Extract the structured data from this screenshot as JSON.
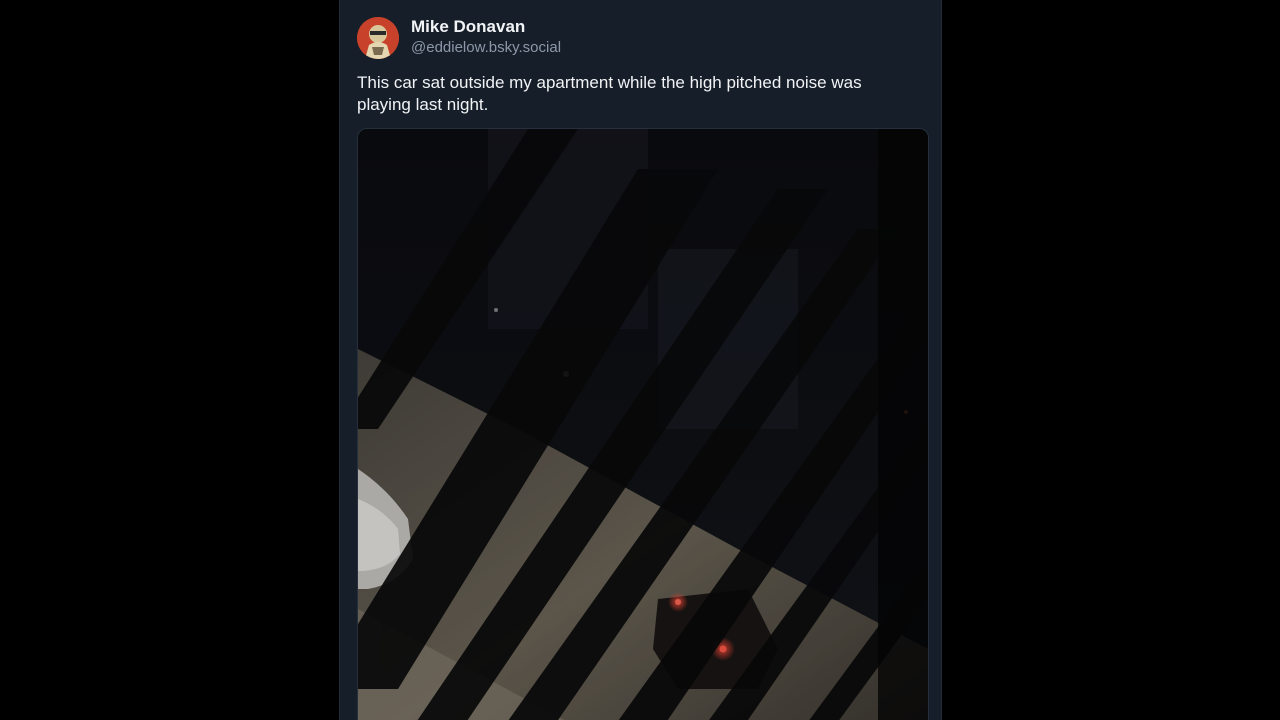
{
  "post": {
    "author_name": "Mike Donavan",
    "author_handle": "@eddielow.bsky.social",
    "text": "This car sat outside my apartment while the high pitched noise was playing last night.",
    "avatar_icon": "avatar-image",
    "media_icon": "night-photo-image"
  },
  "colors": {
    "background": "#000000",
    "card": "#161e29",
    "text": "#f1f3f5",
    "muted": "#8c98a8"
  }
}
